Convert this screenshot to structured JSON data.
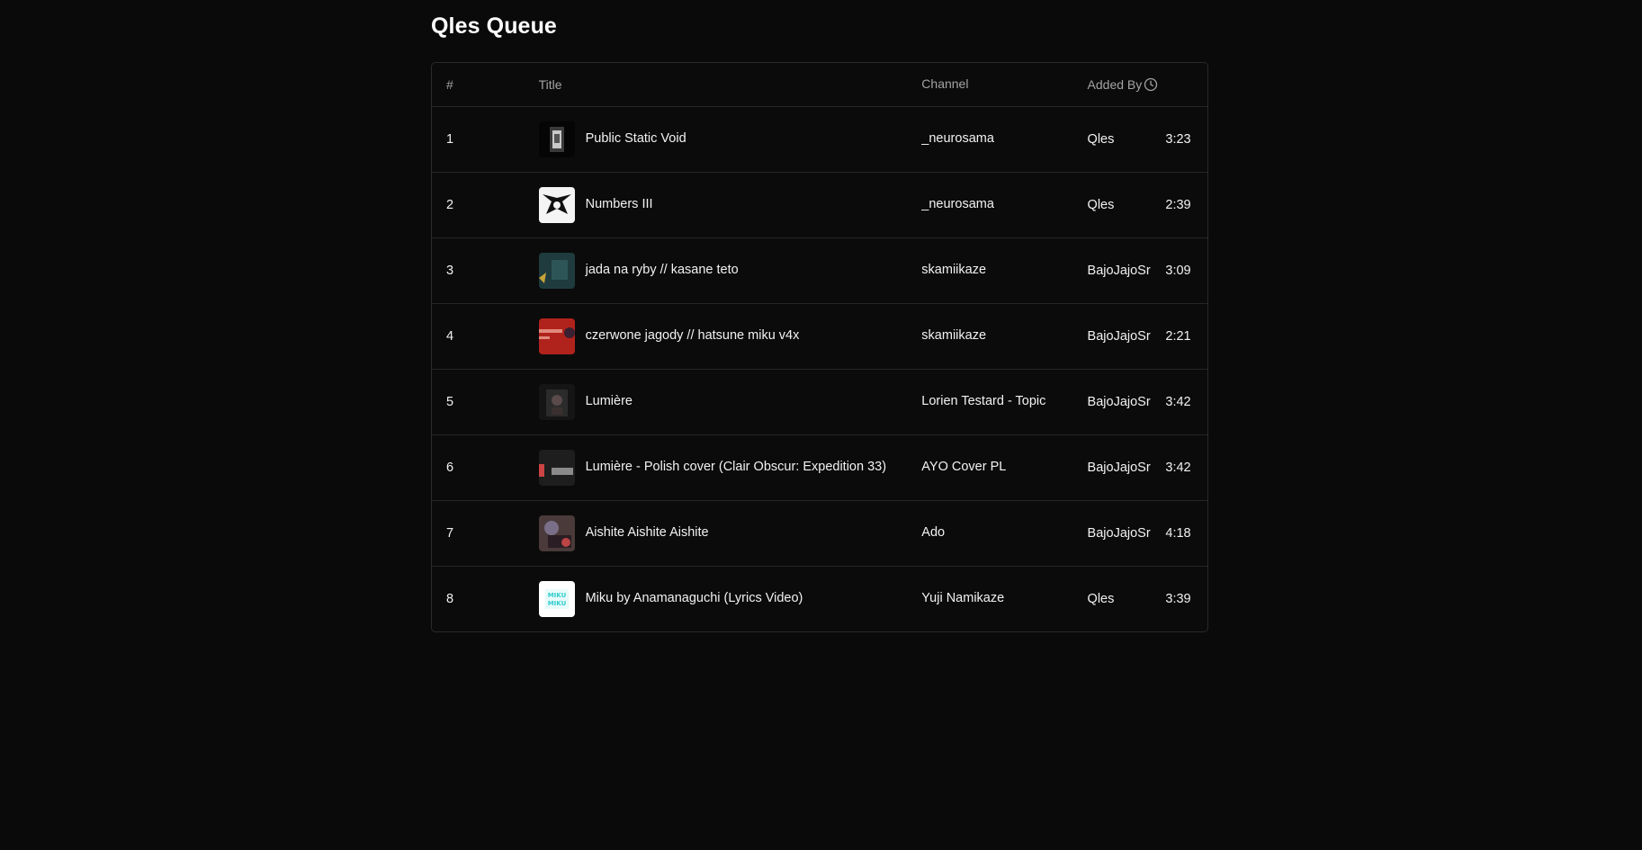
{
  "page": {
    "title": "Qles Queue"
  },
  "table": {
    "headers": {
      "num": "#",
      "title": "Title",
      "channel": "Channel",
      "added_by": "Added By",
      "duration_icon": "clock-icon"
    },
    "rows": [
      {
        "num": "1",
        "title": "Public Static Void",
        "channel": "_neurosama",
        "added_by": "Qles",
        "duration": "3:23",
        "thumb": "neuro-dark"
      },
      {
        "num": "2",
        "title": "Numbers III",
        "channel": "_neurosama",
        "added_by": "Qles",
        "duration": "2:39",
        "thumb": "neuro-white"
      },
      {
        "num": "3",
        "title": "jada na ryby // kasane teto",
        "channel": "skamiikaze",
        "added_by": "BajoJajoSr",
        "duration": "3:09",
        "thumb": "teal"
      },
      {
        "num": "4",
        "title": "czerwone jagody // hatsune miku v4x",
        "channel": "skamiikaze",
        "added_by": "BajoJajoSr",
        "duration": "2:21",
        "thumb": "red"
      },
      {
        "num": "5",
        "title": "Lumière",
        "channel": "Lorien Testard - Topic",
        "added_by": "BajoJajoSr",
        "duration": "3:42",
        "thumb": "lumiere-dark"
      },
      {
        "num": "6",
        "title": "Lumière - Polish cover (Clair Obscur: Expedition 33)",
        "channel": "AYO Cover PL",
        "added_by": "BajoJajoSr",
        "duration": "3:42",
        "thumb": "lumiere-cover"
      },
      {
        "num": "7",
        "title": "Aishite Aishite Aishite",
        "channel": "Ado",
        "added_by": "BajoJajoSr",
        "duration": "4:18",
        "thumb": "ado"
      },
      {
        "num": "8",
        "title": "Miku by Anamanaguchi (Lyrics Video)",
        "channel": "Yuji Namikaze",
        "added_by": "Qles",
        "duration": "3:39",
        "thumb": "miku"
      }
    ]
  },
  "colors": {
    "background": "#0a0a0a",
    "border": "#2a2a2a",
    "text": "#f2f2f2",
    "muted": "#a3a3a3"
  }
}
